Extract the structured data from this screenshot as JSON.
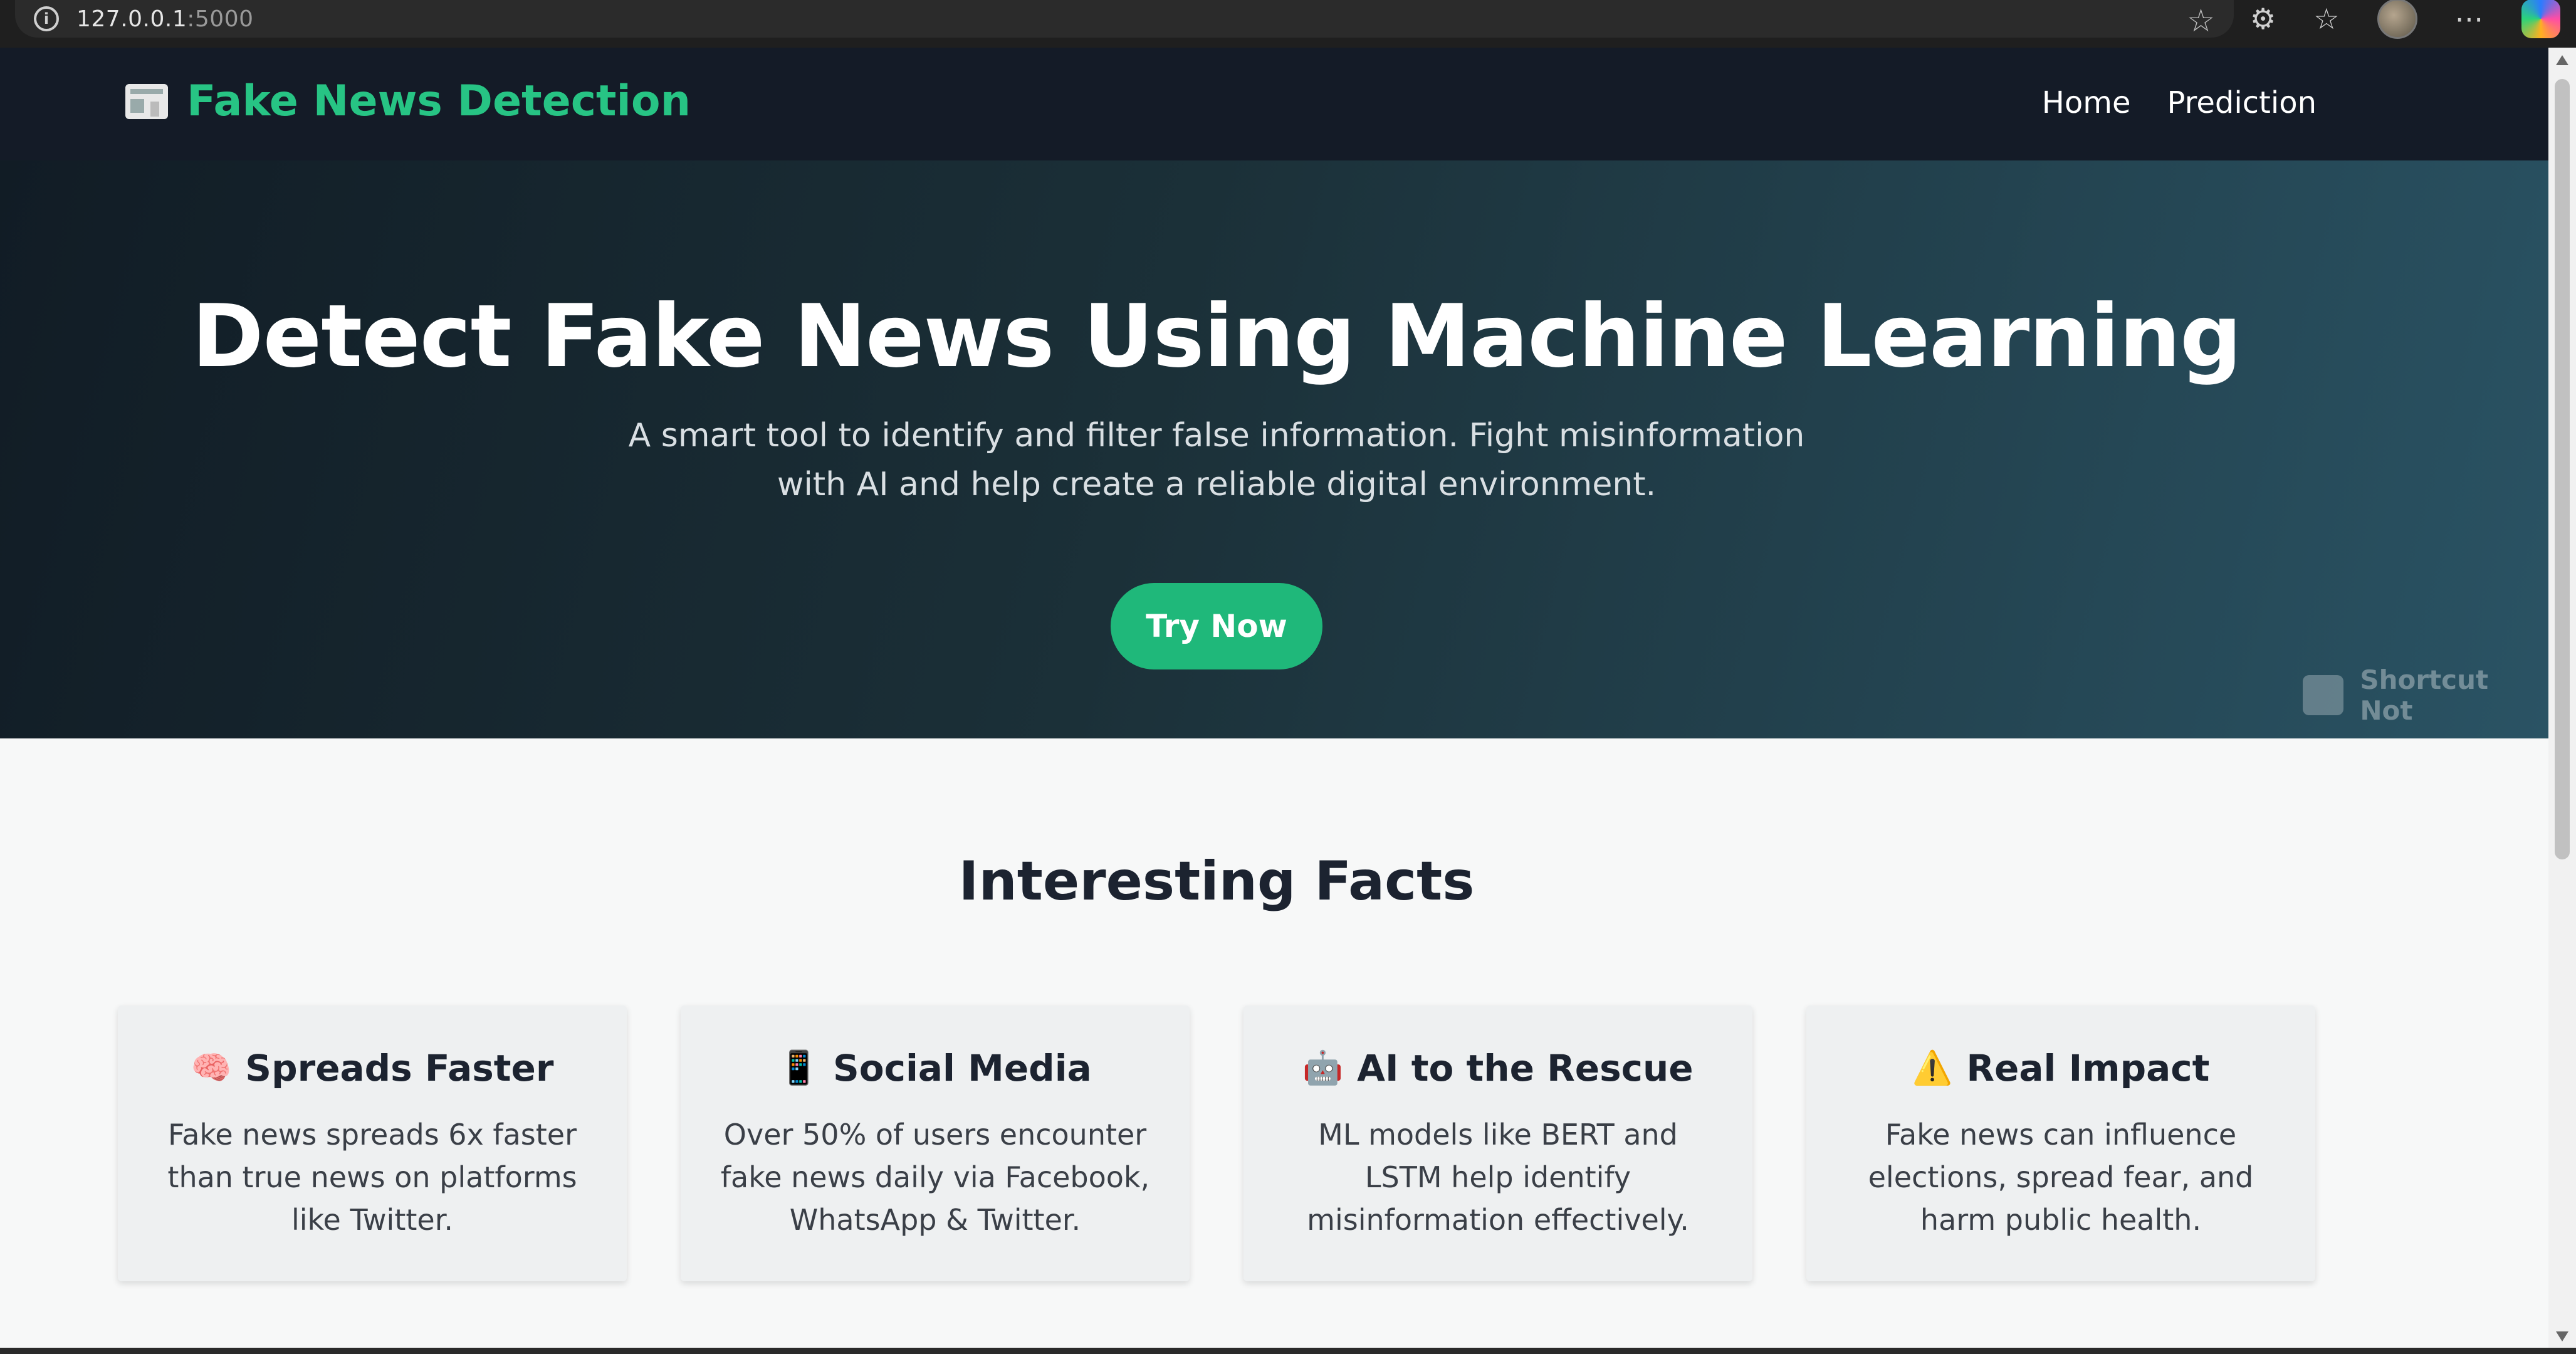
{
  "browser": {
    "url_host": "127.0.0.1",
    "url_port": ":5000"
  },
  "navbar": {
    "brand": "Fake News Detection",
    "links": [
      {
        "label": "Home"
      },
      {
        "label": "Prediction"
      }
    ]
  },
  "hero": {
    "title": "Detect Fake News Using Machine Learning",
    "subtitle": "A smart tool to identify and filter false information. Fight misinformation with AI and help create a reliable digital environment.",
    "cta_label": "Try Now"
  },
  "watermark": {
    "label": "Shortcut Not"
  },
  "facts": {
    "title": "Interesting Facts",
    "cards": [
      {
        "icon": "🧠",
        "title": "Spreads Faster",
        "text": "Fake news spreads 6x faster than true news on platforms like Twitter."
      },
      {
        "icon": "📱",
        "title": "Social Media",
        "text": "Over 50% of users encounter fake news daily via Facebook, WhatsApp & Twitter."
      },
      {
        "icon": "🤖",
        "title": "AI to the Rescue",
        "text": "ML models like BERT and LSTM help identify misinformation effectively."
      },
      {
        "icon": "⚠️",
        "title": "Real Impact",
        "text": "Fake news can influence elections, spread fear, and harm public health."
      }
    ]
  }
}
